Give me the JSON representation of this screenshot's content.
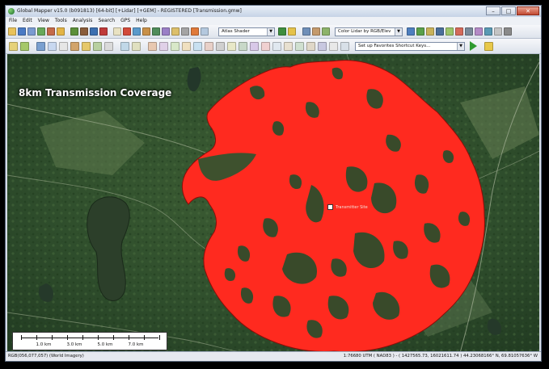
{
  "window": {
    "title": "Global Mapper v15.0 (b091813) [64-bit] [+Lidar] [+GEM] - REGISTERED [Transmission.gmw]",
    "controls": {
      "minimize": "–",
      "maximize": "□",
      "close": "✕"
    }
  },
  "menu": [
    "File",
    "Edit",
    "View",
    "Tools",
    "Analysis",
    "Search",
    "GPS",
    "Help"
  ],
  "toolbar1": {
    "shader_select": "Atlas Shader",
    "color_select": "Color Lidar by RGB/Elev"
  },
  "toolbar2": {
    "shortcut_select": "Set up Favorites Shortcut Keys..."
  },
  "map": {
    "overlay_title": "8km Transmission Coverage",
    "coverage_color": "#ff2a1f",
    "marker_label": "Transmitter Site",
    "scalebar": {
      "labels": [
        "1.0 km",
        "3.0 km",
        "5.0 km",
        "7.0 km"
      ]
    }
  },
  "status": {
    "left": "RGB(056,077,057) (World Imagery)",
    "right": "1:76680   UTM ( NAD83 ) - ( 1427565.73, 16021611.74 )   44.23068166° N, 69.81057636° W"
  },
  "icons": {
    "app": "globe-icon",
    "toolbar_buttons": [
      "open-icon",
      "save-icon",
      "print-icon",
      "layers-icon",
      "zoom-in-icon",
      "zoom-out-icon",
      "pan-icon",
      "measure-icon",
      "digitize-icon",
      "3d-view-icon"
    ]
  }
}
